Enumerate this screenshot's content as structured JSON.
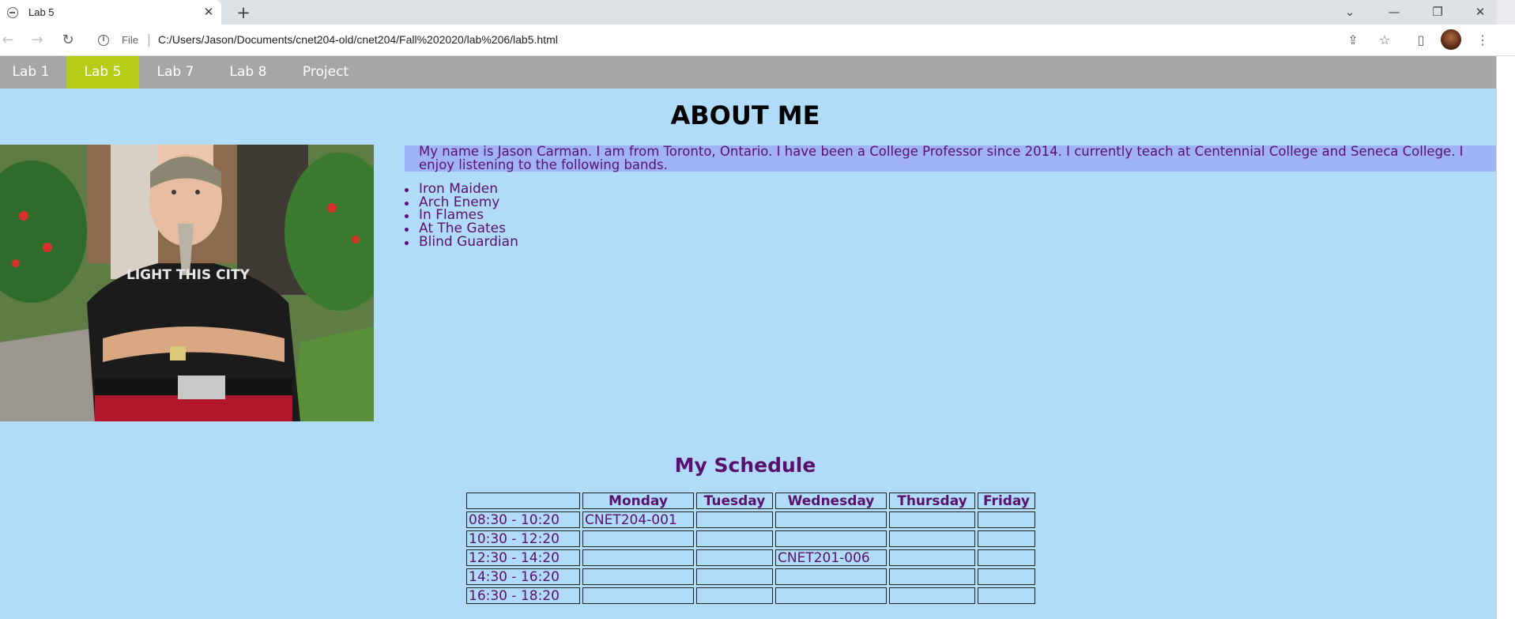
{
  "browser": {
    "tab_title": "Lab 5",
    "tab_close": "✕",
    "new_tab": "+",
    "window_controls": {
      "dropdown": "⌄",
      "minimize": "—",
      "restore": "❐",
      "close": "✕"
    },
    "back": "←",
    "forward": "→",
    "reload": "↻",
    "site_info": "i",
    "file_label": "File",
    "url": "C:/Users/Jason/Documents/cnet204-old/cnet204/Fall%202020/lab%206/lab5.html",
    "share_icon": "⇪",
    "bookmark_icon": "☆",
    "sidepanel_icon": "▯",
    "menu_icon": "⋮"
  },
  "page_nav": [
    {
      "label": "Lab 1",
      "active": false
    },
    {
      "label": "Lab 5",
      "active": true
    },
    {
      "label": "Lab 7",
      "active": false
    },
    {
      "label": "Lab 8",
      "active": false
    },
    {
      "label": "Project",
      "active": false
    }
  ],
  "about": {
    "title": "ABOUT ME",
    "intro": "My name is Jason Carman. I am from Toronto, Ontario. I have been a College Professor since 2014. I currently teach at Centennial College and Seneca College. I enjoy listening to the following bands.",
    "bands": [
      "Iron Maiden",
      "Arch Enemy",
      "In Flames",
      "At The Gates",
      "Blind Guardian"
    ],
    "photo_shirt_text": "LIGHT THIS CITY"
  },
  "schedule": {
    "title": "My Schedule",
    "headers": [
      "",
      "Monday",
      "Tuesday",
      "Wednesday",
      "Thursday",
      "Friday"
    ],
    "rows": [
      [
        "08:30 - 10:20",
        "CNET204-001",
        "",
        "",
        "",
        ""
      ],
      [
        "10:30 - 12:20",
        "",
        "",
        "",
        "",
        ""
      ],
      [
        "12:30 - 14:20",
        "",
        "",
        "CNET201-006",
        "",
        ""
      ],
      [
        "14:30 - 16:20",
        "",
        "",
        "",
        "",
        ""
      ],
      [
        "16:30 - 18:20",
        "",
        "",
        "",
        "",
        ""
      ]
    ]
  },
  "colors": {
    "page_bg": "#b0dcfa",
    "nav_bg": "#a6a6a6",
    "nav_active": "#b6cc18",
    "intro_bg": "#a0b4f5",
    "text_purple": "#5a0f6e"
  }
}
